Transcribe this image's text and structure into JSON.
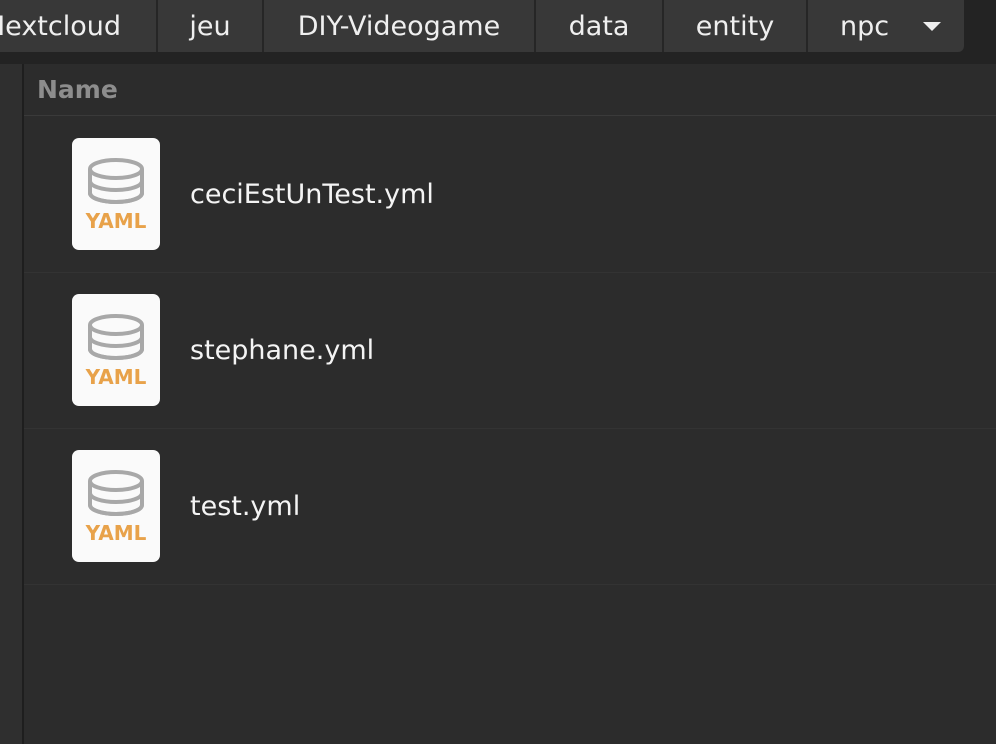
{
  "breadcrumb": {
    "items": [
      {
        "label": "Nextcloud"
      },
      {
        "label": "jeu"
      },
      {
        "label": "DIY-Videogame"
      },
      {
        "label": "data"
      },
      {
        "label": "entity"
      },
      {
        "label": "npc"
      }
    ],
    "dropdown_icon": "pan-down-icon"
  },
  "list": {
    "column_header": "Name",
    "files": [
      {
        "name": "ceciEstUnTest.yml",
        "icon": "yaml-file-icon",
        "icon_badge": "YAML"
      },
      {
        "name": "stephane.yml",
        "icon": "yaml-file-icon",
        "icon_badge": "YAML"
      },
      {
        "name": "test.yml",
        "icon": "yaml-file-icon",
        "icon_badge": "YAML"
      }
    ]
  },
  "colors": {
    "background": "#2c2c2c",
    "pathbar_button": "#383838",
    "yaml_badge": "#e8a24a",
    "database_icon": "#a8a8a8"
  }
}
